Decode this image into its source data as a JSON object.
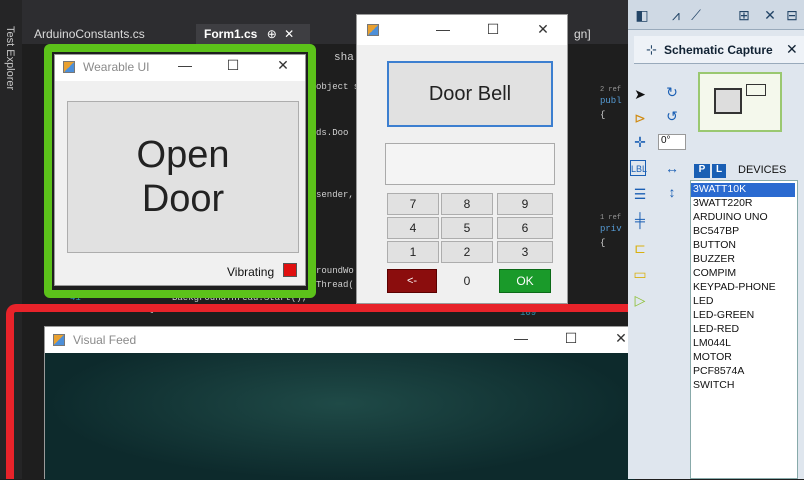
{
  "ide": {
    "tabs": [
      "ArduinoConstants.cs",
      "Form1.cs",
      "gn]"
    ],
    "tab_close": "✕",
    "pin_icon": "⊕",
    "side_label": "Test Explorer",
    "code_lines": [
      "object s",
      "ds.Doo",
      "sender,",
      "roundWo",
      "Thread(",
      "BackgroundThread.Start();",
      "}"
    ],
    "line_numbers": [
      "41",
      "109"
    ],
    "misc_tokens": [
      "sha",
      "2 ref",
      "publ",
      "{",
      "1 ref",
      "priv",
      "{"
    ]
  },
  "wearable": {
    "title": "Wearable UI",
    "open_door": "Open\nDoor",
    "vibrating_label": "Vibrating",
    "indicator_color": "#e01010"
  },
  "doorbell": {
    "doorbell_label": "Door Bell",
    "display_value": "",
    "keys": [
      "7",
      "8",
      "9",
      "4",
      "5",
      "6",
      "1",
      "2",
      "3",
      "<-",
      "0",
      "OK"
    ]
  },
  "visual_feed": {
    "title": "Visual Feed"
  },
  "schematic": {
    "title": "Schematic Capture",
    "angle": "0°",
    "devices_header": "DEVICES",
    "badge_p": "P",
    "badge_l": "L",
    "devices": [
      "3WATT10K",
      "3WATT220R",
      "ARDUINO UNO",
      "BC547BP",
      "BUTTON",
      "BUZZER",
      "COMPIM",
      "KEYPAD-PHONE",
      "LED",
      "LED-GREEN",
      "LED-RED",
      "LM044L",
      "MOTOR",
      "PCF8574A",
      "SWITCH"
    ],
    "selected_device": "3WATT10K"
  },
  "window_controls": {
    "minimize": "—",
    "maximize": "☐",
    "close": "✕"
  },
  "highlight_colors": {
    "wearable_frame": "#5cc21a",
    "feed_frame": "#e8232a"
  }
}
